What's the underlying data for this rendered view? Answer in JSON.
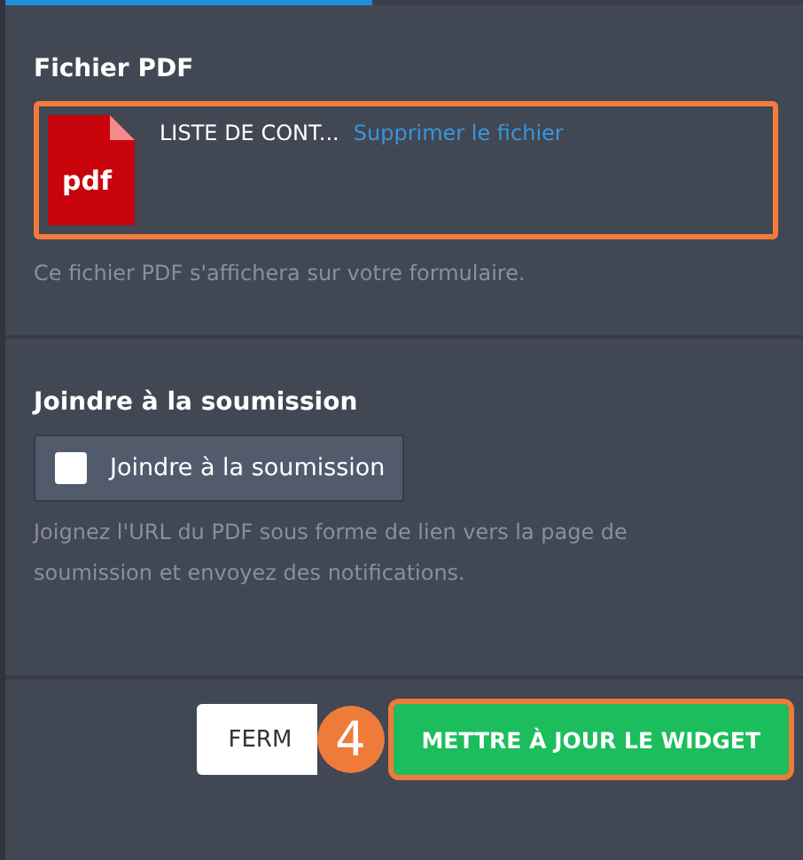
{
  "tabs_indicator": {
    "level": 0.46
  },
  "pdf_section": {
    "title": "Fichier PDF",
    "file_name": "LISTE DE CONT...",
    "remove_link": "Supprimer le fichier",
    "highlighted": true,
    "hint": "Ce fichier PDF s'affichera sur votre formulaire.",
    "icon_text": "pdf"
  },
  "attach_section": {
    "title": "Joindre à la soumission",
    "checkbox": {
      "label": "Joindre à la soumission",
      "checked": false
    },
    "hint": "Joignez l'URL du PDF sous forme de lien vers la page de soumission et envoyez des notifications."
  },
  "footer": {
    "close_button": "FERM",
    "update_button": "METTRE À JOUR LE WIDGET",
    "update_highlighted": true,
    "step_badge": "4"
  }
}
